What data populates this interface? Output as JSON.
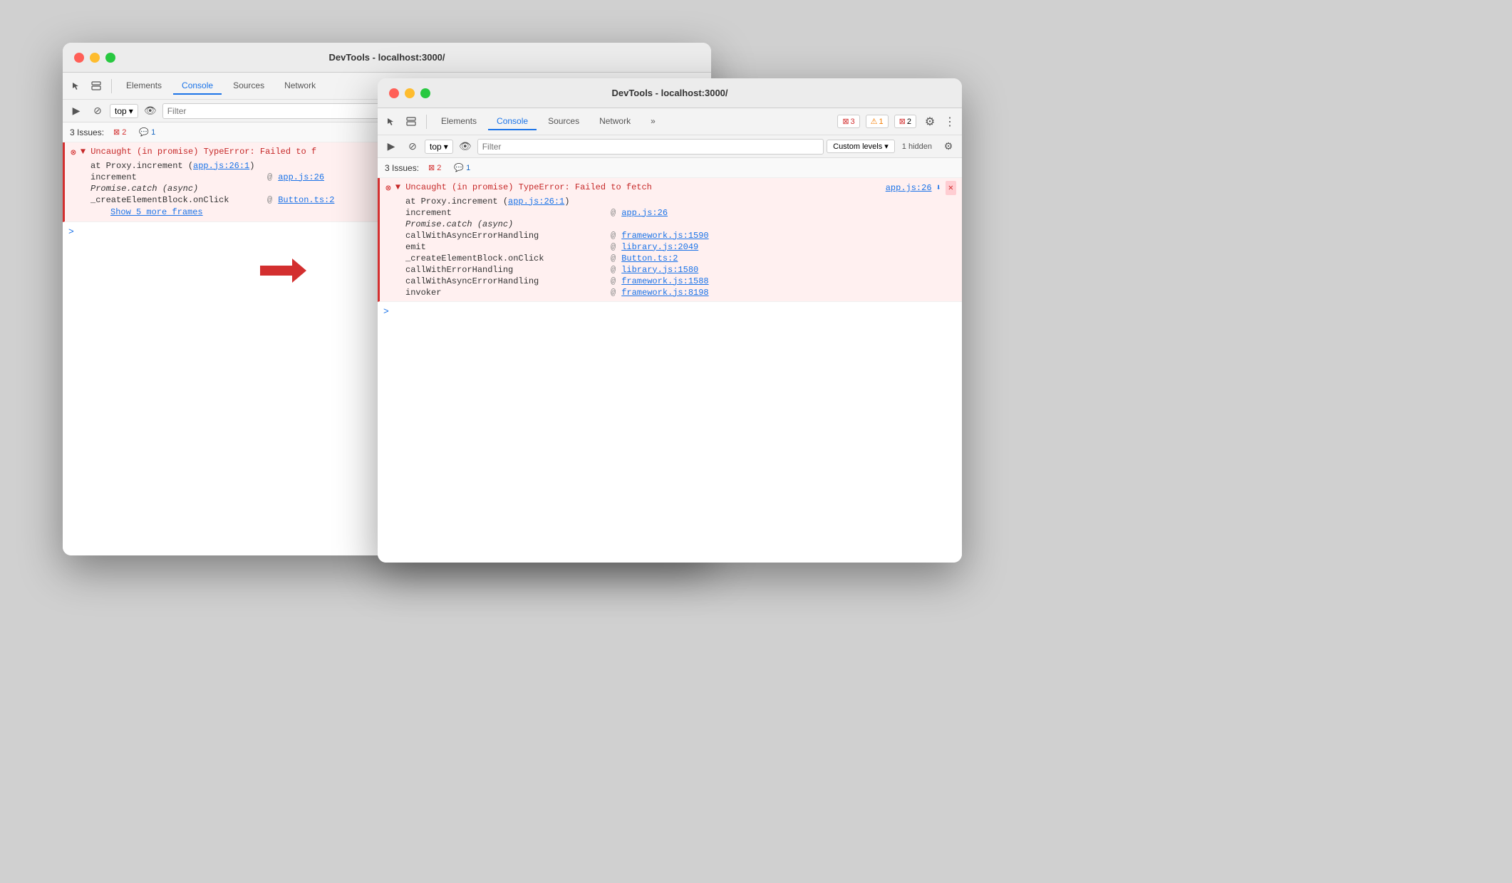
{
  "window_back": {
    "title": "DevTools - localhost:3000/",
    "tabs": [
      {
        "label": "Elements",
        "active": false
      },
      {
        "label": "Console",
        "active": true
      },
      {
        "label": "Sources",
        "active": false
      },
      {
        "label": "Network",
        "active": false
      }
    ],
    "console_toolbar": {
      "top_label": "top",
      "filter_placeholder": "Filter"
    },
    "issues_bar": {
      "label": "3 Issues:",
      "error_count": "2",
      "info_count": "1"
    },
    "error": {
      "main_text": "▼ Uncaught (in promise) TypeError: Failed to f",
      "sub_text": "at Proxy.increment (app.js:26:1)",
      "link": "app.js:26",
      "stack": [
        {
          "func": "increment",
          "file": "app.js:26"
        },
        {
          "func": "Promise.catch (async)",
          "file": ""
        },
        {
          "func": "_createElementBlock.onClick",
          "file": "Button.ts:2"
        }
      ],
      "show_more": "Show 5 more frames"
    },
    "prompt": ">"
  },
  "window_front": {
    "title": "DevTools - localhost:3000/",
    "tabs": [
      {
        "label": "Elements",
        "active": false
      },
      {
        "label": "Console",
        "active": true
      },
      {
        "label": "Sources",
        "active": false
      },
      {
        "label": "Network",
        "active": false
      }
    ],
    "toolbar_right": {
      "error_count": "3",
      "warn_count": "1",
      "error2_count": "2",
      "gear": "⚙",
      "more": "⋮"
    },
    "console_toolbar": {
      "top_label": "top",
      "filter_placeholder": "Filter",
      "custom_levels": "Custom levels ▾",
      "hidden": "1 hidden"
    },
    "issues_bar": {
      "label": "3 Issues:",
      "error_count": "2",
      "info_count": "1"
    },
    "error": {
      "main_text": "▼ Uncaught (in promise) TypeError: Failed to fetch",
      "sub_text": "at Proxy.increment (app.js:26:1)",
      "file_link": "app.js:26",
      "stack": [
        {
          "func": "increment",
          "at": "@",
          "file": "app.js:26",
          "italic": false
        },
        {
          "func": "Promise.catch (async)",
          "at": "",
          "file": "",
          "italic": true
        },
        {
          "func": "callWithAsyncErrorHandling",
          "at": "@",
          "file": "framework.js:1590",
          "italic": false
        },
        {
          "func": "emit",
          "at": "@",
          "file": "library.js:2049",
          "italic": false
        },
        {
          "func": "_createElementBlock.onClick",
          "at": "@",
          "file": "Button.ts:2",
          "italic": false
        },
        {
          "func": "callWithErrorHandling",
          "at": "@",
          "file": "library.js:1580",
          "italic": false
        },
        {
          "func": "callWithAsyncErrorHandling",
          "at": "@",
          "file": "framework.js:1588",
          "italic": false
        },
        {
          "func": "invoker",
          "at": "@",
          "file": "framework.js:8198",
          "italic": false
        }
      ]
    },
    "prompt": ">"
  },
  "arrow": {
    "symbol": "➔"
  }
}
